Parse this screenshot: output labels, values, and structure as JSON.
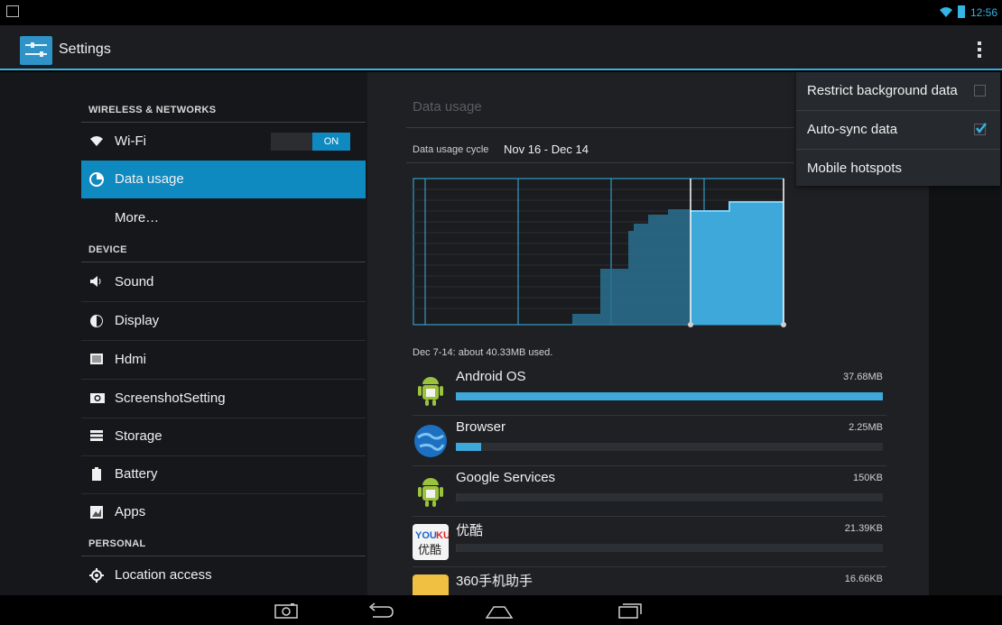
{
  "status_bar": {
    "time": "12:56"
  },
  "action_bar": {
    "title": "Settings"
  },
  "sidebar": {
    "sections": [
      {
        "header": "WIRELESS & NETWORKS"
      },
      {
        "header": "DEVICE"
      },
      {
        "header": "PERSONAL"
      }
    ],
    "items": [
      {
        "label": "Wi-Fi",
        "icon": "wifi-icon"
      },
      {
        "label": "Data usage",
        "icon": "data-usage-icon",
        "selected": true
      },
      {
        "label": "More…",
        "icon": ""
      },
      {
        "label": "Sound",
        "icon": "sound-icon"
      },
      {
        "label": "Display",
        "icon": "display-icon"
      },
      {
        "label": "Hdmi",
        "icon": "hdmi-icon"
      },
      {
        "label": "ScreenshotSetting",
        "icon": "camera-icon"
      },
      {
        "label": "Storage",
        "icon": "storage-icon"
      },
      {
        "label": "Battery",
        "icon": "battery-icon"
      },
      {
        "label": "Apps",
        "icon": "apps-icon"
      },
      {
        "label": "Location access",
        "icon": "location-icon"
      }
    ],
    "wifi_toggle": "ON"
  },
  "data_usage": {
    "title": "Data usage",
    "cycle_label": "Data usage cycle",
    "cycle_value": "Nov 16 - Dec 14",
    "summary": "Dec 7-14: about 40.33MB used.",
    "apps": [
      {
        "name": "Android OS",
        "size": "37.68MB",
        "fraction": 1.0,
        "icon": "android-icon"
      },
      {
        "name": "Browser",
        "size": "2.25MB",
        "fraction": 0.06,
        "icon": "browser-globe-icon"
      },
      {
        "name": "Google Services",
        "size": "150KB",
        "fraction": 0.004,
        "icon": "android-icon"
      },
      {
        "name": "优酷",
        "size": "21.39KB",
        "fraction": 0.001,
        "icon": "youku-icon",
        "icon_text": "YOUKU 优酷"
      },
      {
        "name": "360手机助手",
        "size": "16.66KB",
        "fraction": 0.001,
        "icon": "360-assistant-icon"
      }
    ]
  },
  "overflow_menu": {
    "items": [
      {
        "label": "Restrict background data",
        "checked": false
      },
      {
        "label": "Auto-sync data",
        "checked": true
      },
      {
        "label": "Mobile hotspots"
      }
    ]
  },
  "colors": {
    "accent": "#34b5e5",
    "selected": "#0e8ac0",
    "bar": "#3ea8db"
  }
}
